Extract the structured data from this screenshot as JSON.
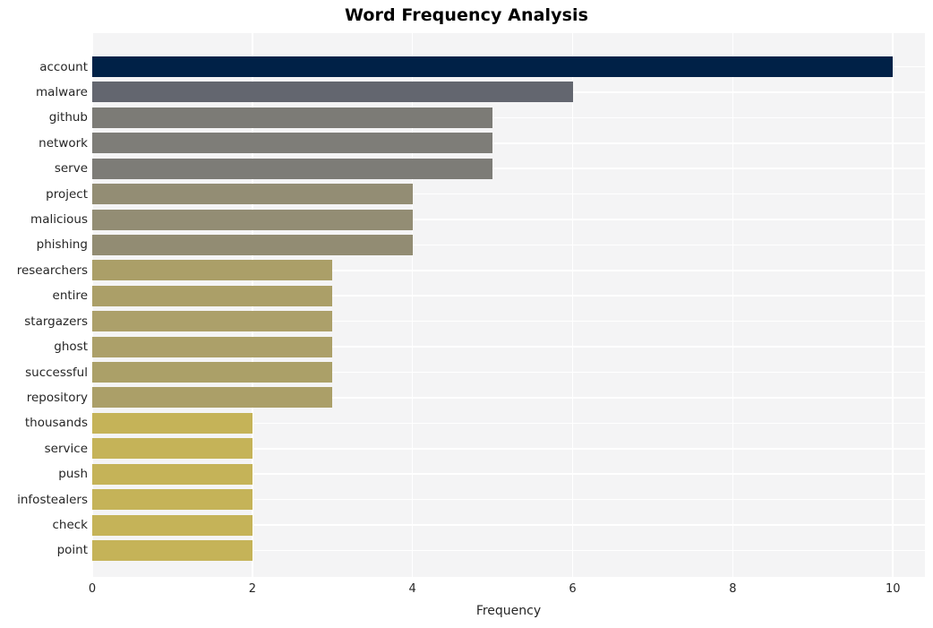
{
  "chart_data": {
    "type": "bar",
    "orientation": "horizontal",
    "title": "Word Frequency Analysis",
    "xlabel": "Frequency",
    "ylabel": "",
    "xlim": [
      0,
      10.4
    ],
    "xticks": [
      "0",
      "2",
      "4",
      "6",
      "8",
      "10"
    ],
    "xtick_values": [
      0,
      2,
      4,
      6,
      8,
      10
    ],
    "grid": true,
    "legend": "none",
    "categories": [
      "account",
      "malware",
      "github",
      "network",
      "serve",
      "project",
      "malicious",
      "phishing",
      "researchers",
      "entire",
      "stargazers",
      "ghost",
      "successful",
      "repository",
      "thousands",
      "service",
      "push",
      "infostealers",
      "check",
      "point"
    ],
    "values": [
      10,
      6,
      5,
      5,
      5,
      4,
      4,
      4,
      3,
      3,
      3,
      3,
      3,
      3,
      2,
      2,
      2,
      2,
      2,
      2
    ],
    "bar_colors": [
      "#002147",
      "#63666f",
      "#7c7b76",
      "#7e7d78",
      "#7d7c77",
      "#938d74",
      "#938d74",
      "#928c73",
      "#ab9f68",
      "#ab9f68",
      "#ac a06a",
      "#aca069",
      "#aba068",
      "#ab9f68",
      "#c5b358",
      "#c5b358",
      "#c5b358",
      "#c5b358",
      "#c5b358",
      "#c5b358"
    ]
  },
  "style": {
    "plot_background": "#f4f4f5",
    "grid_color": "#ffffff",
    "figure_background": "#ffffff",
    "tick_text_color": "#262626",
    "title_color": "#000000"
  }
}
